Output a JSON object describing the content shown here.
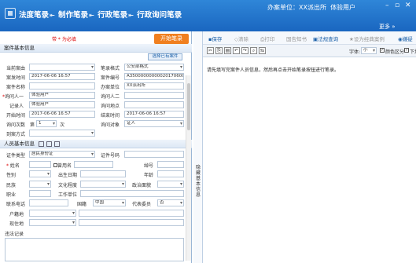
{
  "header": {
    "crumbs": [
      "法度笔录",
      "制作笔录",
      "行政笔录",
      "行政询问笔录"
    ],
    "unit_label": "办案单位：XX派出所",
    "user": "体验用户",
    "more": "更多 »"
  },
  "left": {
    "required_note": "带 * 为必填",
    "start_button": "开始笔录",
    "section_case": "案件基本信息",
    "select_case_button": "选择已有案件",
    "fields": {
      "current_reason_label": "当前案由",
      "record_format_label": "笔录格式",
      "record_format_value": "公安部格式",
      "case_time_label": "案发时间",
      "case_time_value": "2017-06-06 16:57",
      "case_no_label": "案件编号",
      "case_no_value": "A3500000000002017060001",
      "case_name_label": "案件名称",
      "case_unit_label": "办案单位",
      "case_unit_value": "XX派出所",
      "interrogator1_label": "询问人一",
      "interrogator1_value": "体验用户",
      "interrogator2_label": "询问人二",
      "recorder_label": "记录人",
      "recorder_value": "体验用户",
      "place_label": "询问地点",
      "start_time_label": "开始时间",
      "start_time_value": "2017-06-06 16:57",
      "end_time_label": "结束时间",
      "end_time_value": "2017-06-06 16:57",
      "count_label": "询问次数",
      "count_prefix": "第",
      "count_value": "1",
      "count_suffix": "次",
      "object_label": "询问对象",
      "object_value": "证人",
      "arrival_label": "到案方式"
    },
    "section_person": "人员基本信息",
    "person": {
      "id_type_label": "证件类型",
      "id_type_value": "居民身份证",
      "id_no_label": "证件号码",
      "name_label": "姓名",
      "former_name_label": "曾用名",
      "nickname_label": "绰号",
      "gender_label": "性别",
      "dob_label": "出生日期",
      "age_label": "年龄",
      "ethnicity_label": "民族",
      "education_label": "文化程度",
      "political_label": "政治面貌",
      "job_label": "职业",
      "workplace_label": "工作单位",
      "phone_label": "联系电话",
      "nationality_label": "国籍",
      "nationality_value": "中国",
      "deputy_label": "代表委员",
      "deputy_value": "否",
      "hukou_label": "户籍地",
      "residence_label": "现住地",
      "violation_label": "违法记录"
    }
  },
  "divider_text": "隐藏基本信息",
  "right": {
    "toolbar": [
      "保存",
      "清除",
      "打印",
      "国告知书",
      "法规查询",
      "设为经典案例",
      "嫌疑"
    ],
    "font_label": "字体:",
    "font_size": "小",
    "color_label": "颜色区分",
    "underline_label": "下划线",
    "message": "请先填写完案件人员信息，然后再点击开始笔录按钮进行笔录。"
  }
}
